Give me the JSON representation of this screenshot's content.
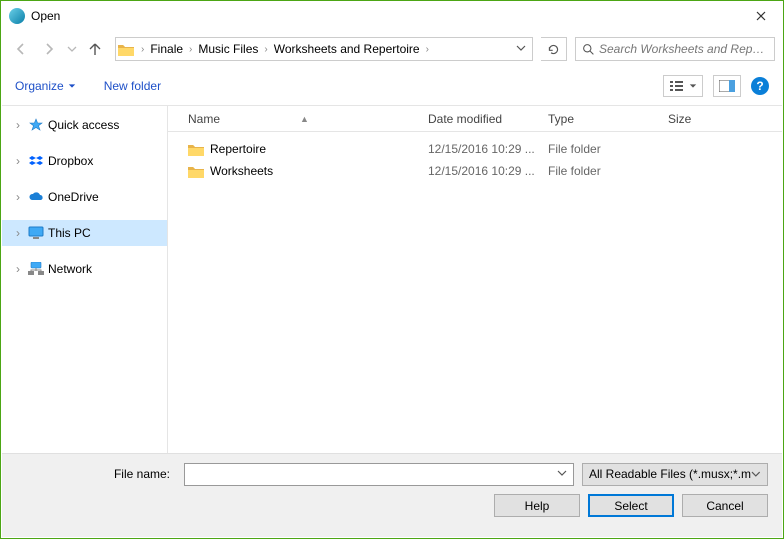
{
  "window": {
    "title": "Open"
  },
  "breadcrumb": {
    "parts": [
      "Finale",
      "Music Files",
      "Worksheets and Repertoire"
    ]
  },
  "search": {
    "placeholder": "Search Worksheets and Reper..."
  },
  "toolbar": {
    "organize": "Organize",
    "new_folder": "New folder"
  },
  "sidebar": {
    "items": [
      {
        "label": "Quick access"
      },
      {
        "label": "Dropbox"
      },
      {
        "label": "OneDrive"
      },
      {
        "label": "This PC"
      },
      {
        "label": "Network"
      }
    ]
  },
  "columns": {
    "name": "Name",
    "date": "Date modified",
    "type": "Type",
    "size": "Size"
  },
  "rows": [
    {
      "name": "Repertoire",
      "date": "12/15/2016 10:29 ...",
      "type": "File folder"
    },
    {
      "name": "Worksheets",
      "date": "12/15/2016 10:29 ...",
      "type": "File folder"
    }
  ],
  "footer": {
    "filename_label": "File name:",
    "filetype": "All Readable Files (*.musx;*.mu",
    "help": "Help",
    "select": "Select",
    "cancel": "Cancel"
  }
}
